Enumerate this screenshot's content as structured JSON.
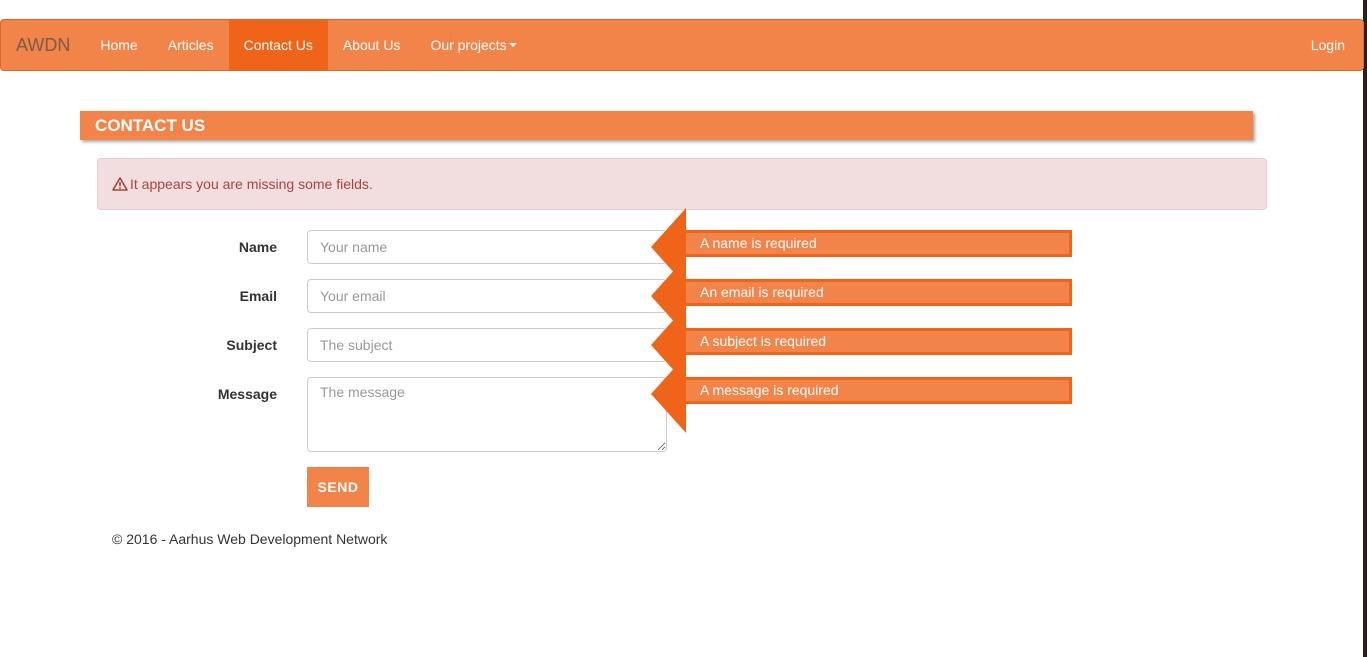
{
  "navbar": {
    "brand": "AWDN",
    "items": [
      {
        "label": "Home"
      },
      {
        "label": "Articles"
      },
      {
        "label": "Contact Us",
        "active": true
      },
      {
        "label": "About Us"
      },
      {
        "label": "Our projects",
        "dropdown": true
      }
    ],
    "login": "Login"
  },
  "page": {
    "heading": "CONTACT US",
    "alert": "It appears you are missing some fields."
  },
  "form": {
    "name": {
      "label": "Name",
      "placeholder": "Your name",
      "value": "",
      "error": "A name is required"
    },
    "email": {
      "label": "Email",
      "placeholder": "Your email",
      "value": "",
      "error": "An email is required"
    },
    "subject": {
      "label": "Subject",
      "placeholder": "The subject",
      "value": "",
      "error": "A subject is required"
    },
    "message": {
      "label": "Message",
      "placeholder": "The message",
      "value": "",
      "error": "A message is required"
    },
    "send_label": "SEND"
  },
  "footer": {
    "text": "© 2016 - Aarhus Web Development Network"
  },
  "colors": {
    "accent": "#f38449",
    "accent_dark": "#ef6418",
    "alert_bg": "#f2dede",
    "alert_text": "#a94442"
  },
  "icons": {
    "alert": "warning-triangle-icon",
    "dropdown": "caret-down-icon"
  }
}
